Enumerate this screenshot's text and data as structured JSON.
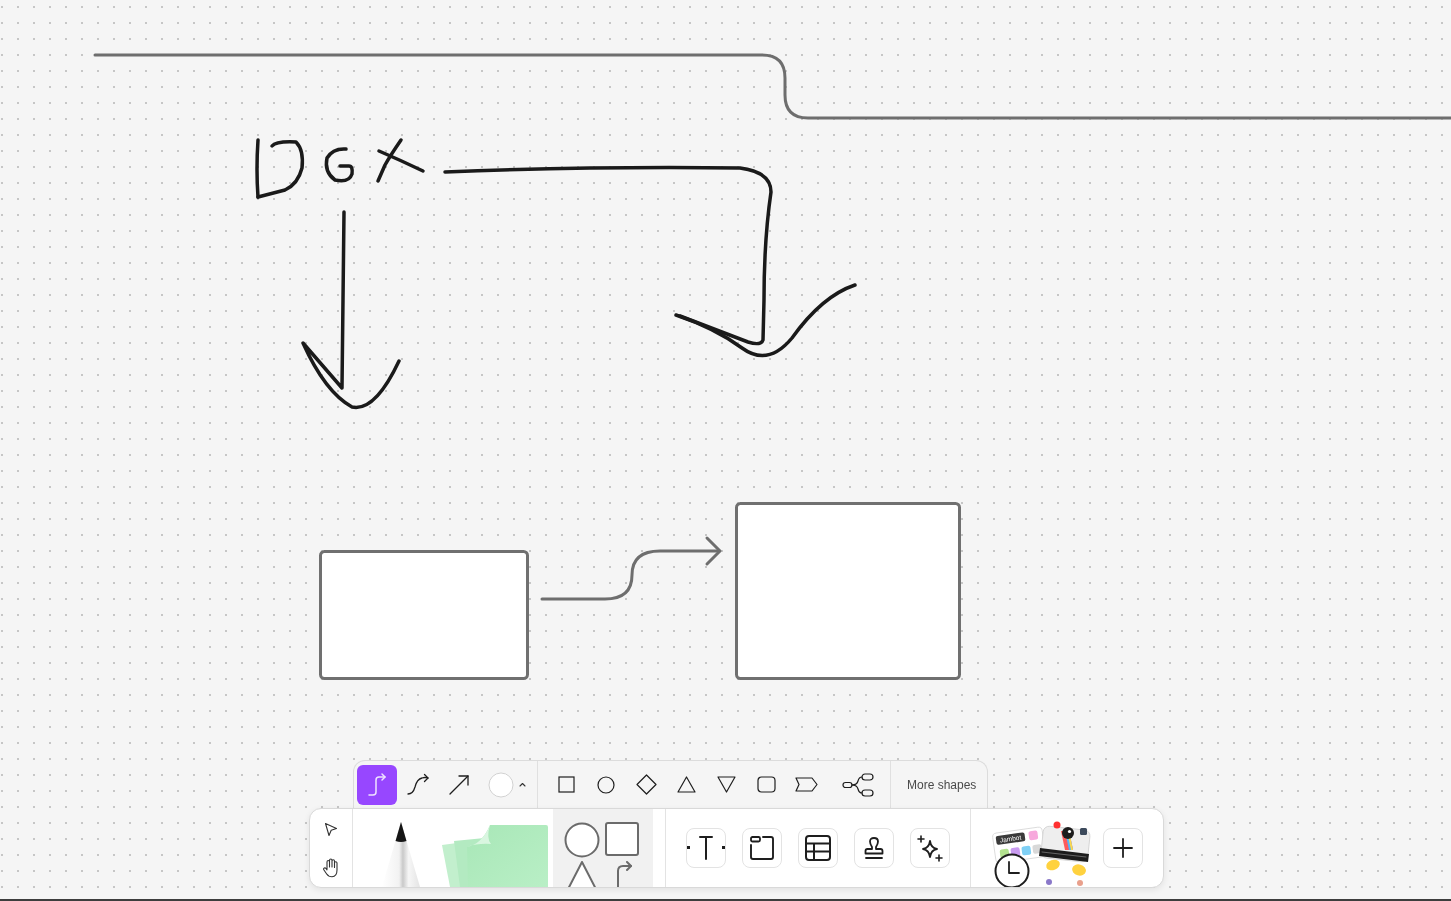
{
  "board": {
    "items": [
      {
        "kind": "connector-line"
      },
      {
        "kind": "handwriting"
      },
      {
        "kind": "ink-arrow"
      },
      {
        "kind": "ink-arrow"
      },
      {
        "kind": "rectangle"
      },
      {
        "kind": "connector-arrow"
      },
      {
        "kind": "rectangle"
      }
    ]
  },
  "shape_toolbar": {
    "connector_styles": [
      {
        "kind": "elbow",
        "selected": true
      },
      {
        "kind": "curved",
        "selected": false
      },
      {
        "kind": "straight",
        "selected": false
      }
    ],
    "color_swatch": {
      "color": "#ffffff"
    },
    "more_shapes": "More shapes"
  },
  "main_toolbar": {
    "widgets": {
      "sticker_label": "Jambot"
    }
  }
}
